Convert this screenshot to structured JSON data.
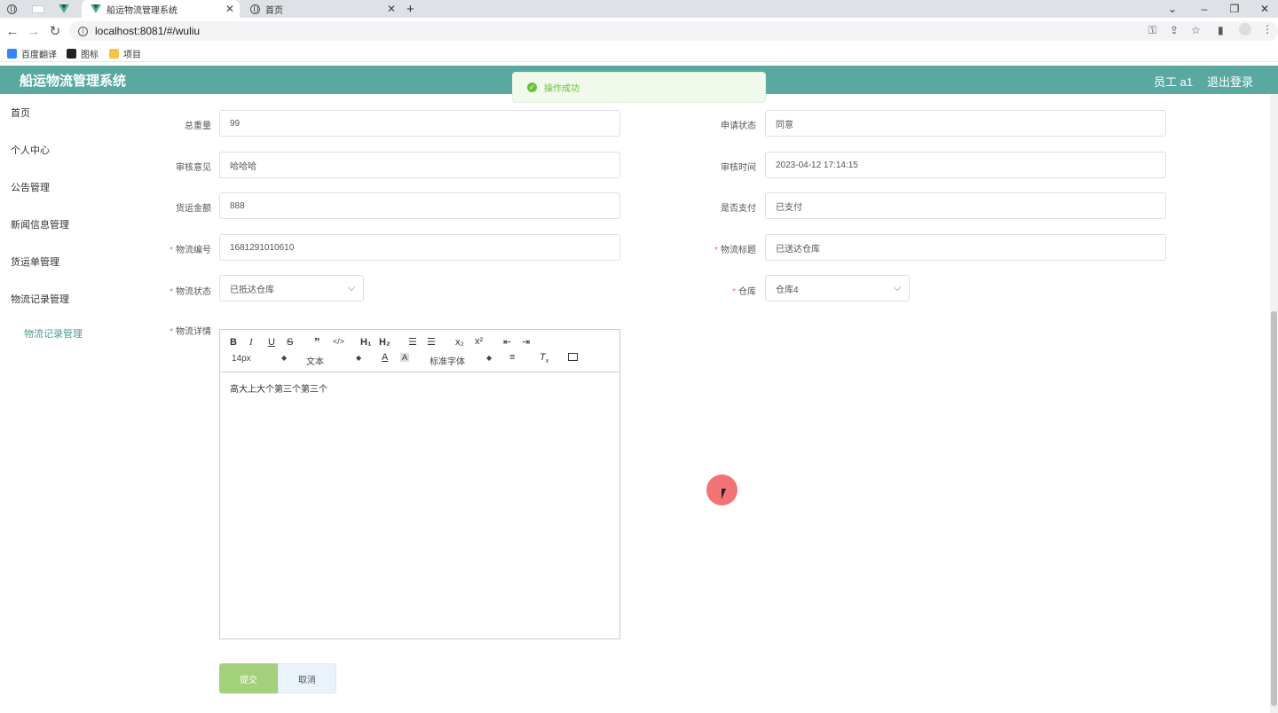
{
  "browser": {
    "tabs": [
      {
        "title": ""
      },
      {
        "title": ""
      },
      {
        "title": "船运物流管理系统"
      },
      {
        "title": "首页"
      }
    ],
    "new_tab": "+",
    "url": "localhost:8081/#/wuliu",
    "bookmarks": [
      {
        "label": "百度翻译",
        "color": "#3385ff"
      },
      {
        "label": "图标",
        "color": "#222222"
      },
      {
        "label": "项目",
        "color": "#f6c342"
      }
    ]
  },
  "header": {
    "title": "船运物流管理系统",
    "user": "员工 a1",
    "logout": "退出登录",
    "color": "#5aa9a0"
  },
  "sidebar": {
    "items": [
      "首页",
      "个人中心",
      "公告管理",
      "新闻信息管理",
      "货运单管理",
      "物流记录管理"
    ],
    "subitem": "物流记录管理"
  },
  "toast": {
    "message": "操作成功"
  },
  "form": {
    "total_weight": {
      "label": "总重量",
      "value": "99"
    },
    "apply_status": {
      "label": "申请状态",
      "value": "同意"
    },
    "review_opinion": {
      "label": "审核意见",
      "value": "哈哈哈"
    },
    "review_time": {
      "label": "审核时间",
      "value": "2023-04-12 17:14:15"
    },
    "freight_amount": {
      "label": "货运金额",
      "value": "888"
    },
    "is_paid": {
      "label": "是否支付",
      "value": "已支付"
    },
    "logistics_no": {
      "label": "物流编号",
      "value": "1681291010610"
    },
    "logistics_title": {
      "label": "物流标题",
      "value": "已送达仓库"
    },
    "logistics_status": {
      "label": "物流状态",
      "value": "已抵达仓库"
    },
    "warehouse": {
      "label": "仓库",
      "value": "仓库4"
    },
    "details": {
      "label": "物流详情",
      "content": "高大上大个第三个第三个"
    },
    "submit": "提交",
    "cancel": "取消"
  },
  "editor": {
    "size_select": "14px",
    "format_select": "文本",
    "font_select": "标准字体"
  }
}
